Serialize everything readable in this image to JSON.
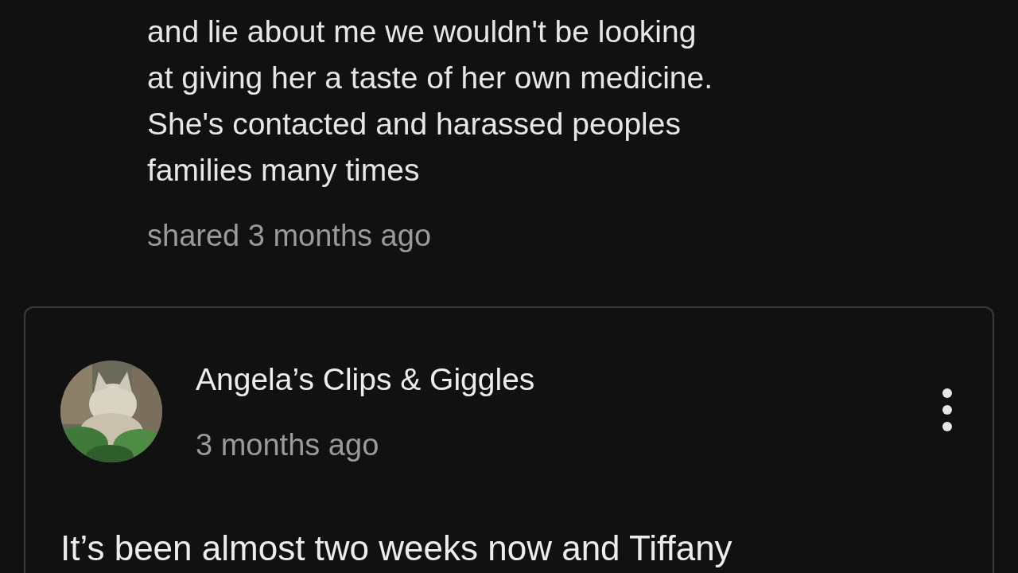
{
  "post": {
    "text_lines": [
      "and lie about me we wouldn't be looking",
      "at giving her a taste of her own medicine.",
      "She's contacted and harassed peoples",
      "families many times"
    ],
    "shared": "shared 3 months ago"
  },
  "comment": {
    "author": "Angela’s Clips & Giggles",
    "time": "3 months ago",
    "body": "It’s been almost two weeks now and Tiffany"
  }
}
